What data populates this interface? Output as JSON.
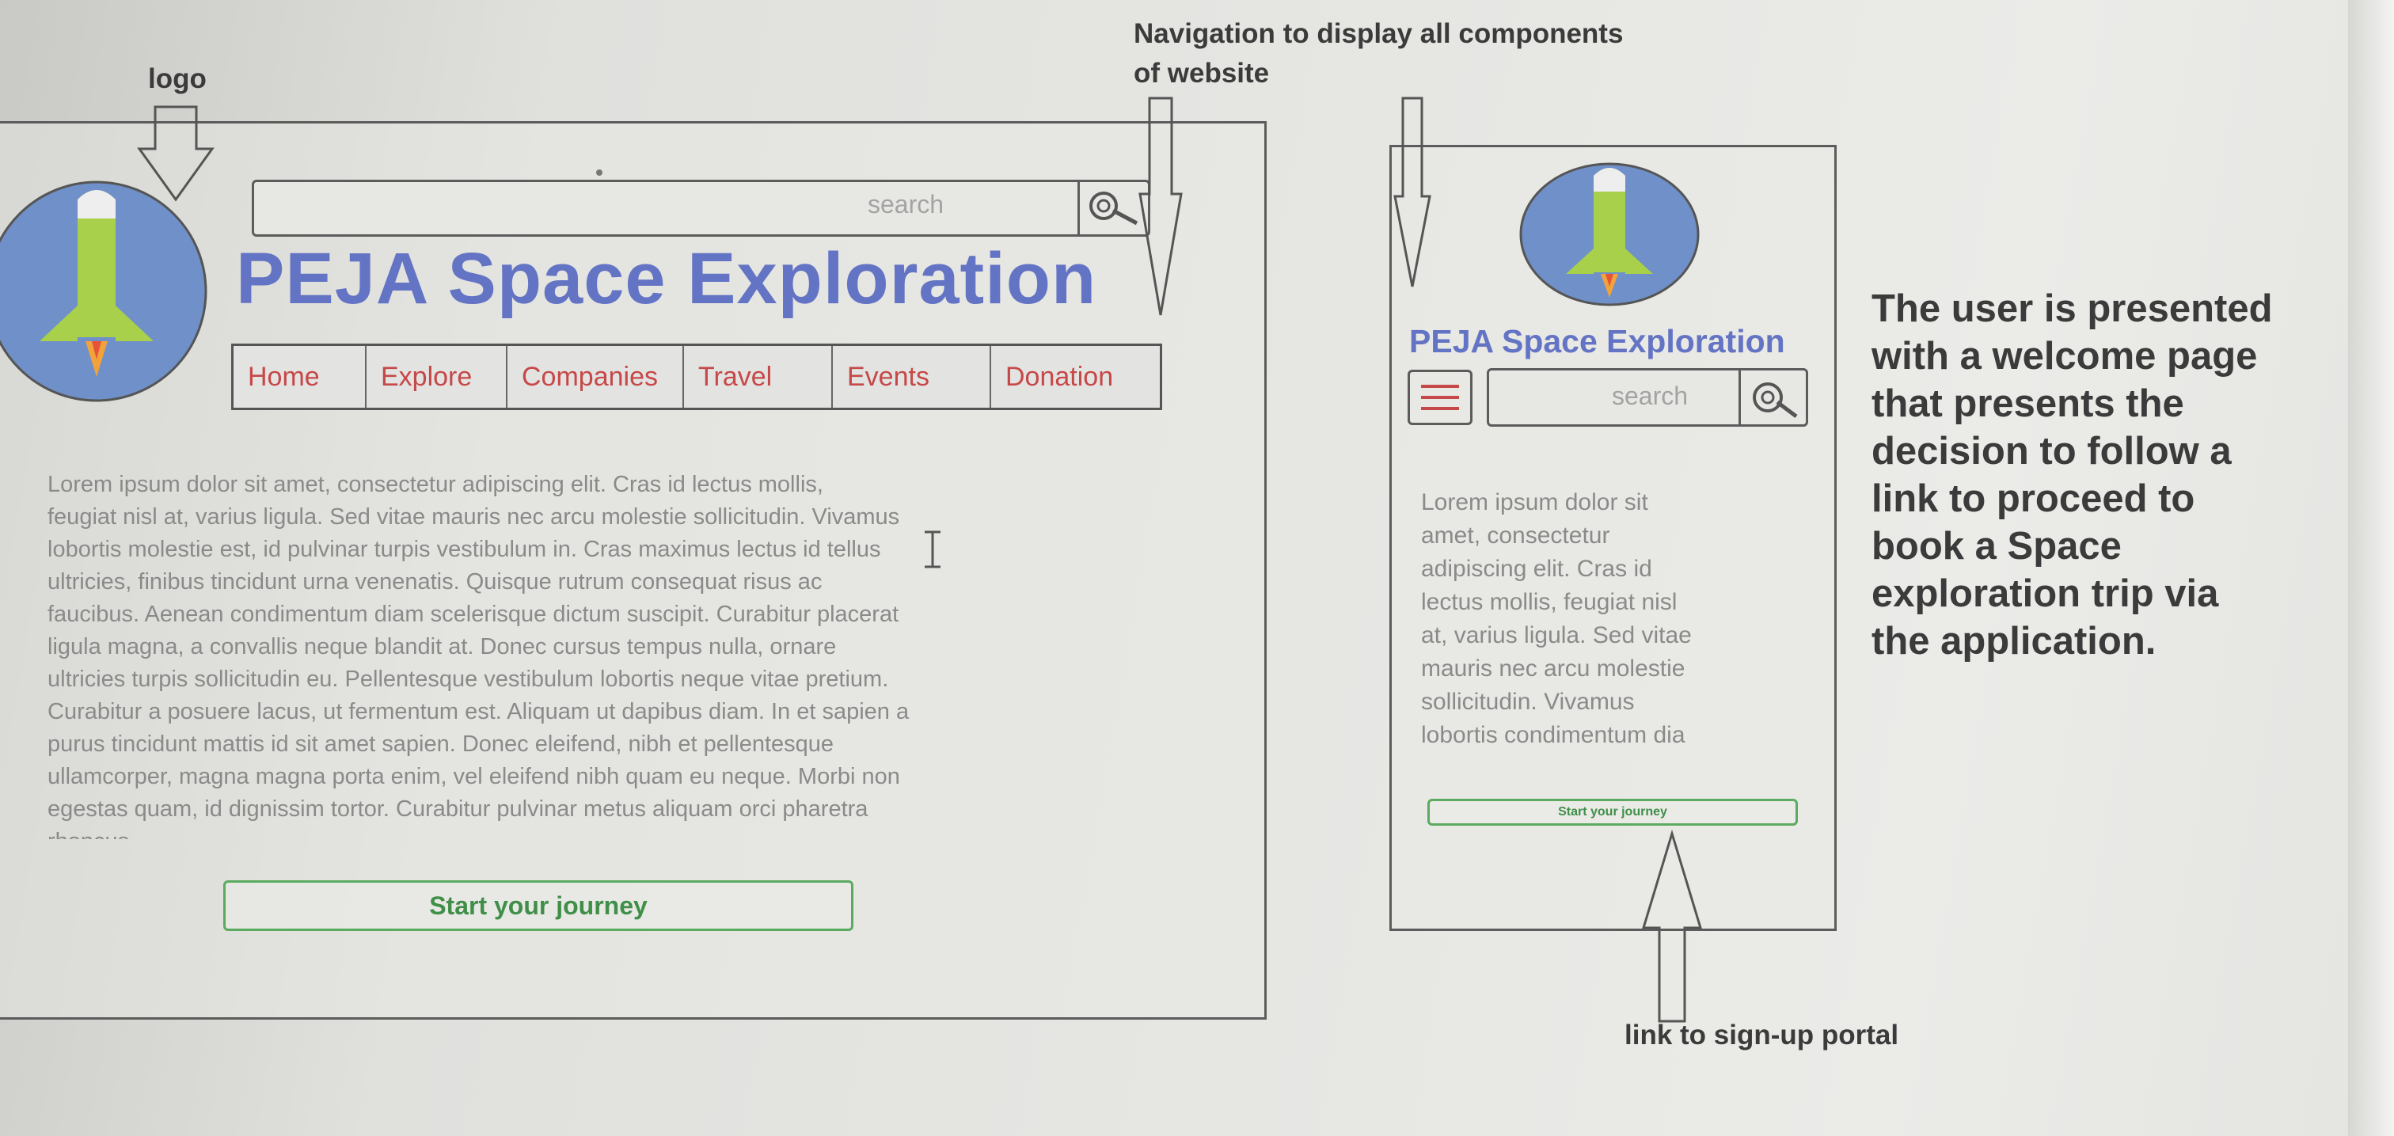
{
  "annotations": {
    "logo": "logo",
    "navigation_line1": "Navigation to display all components",
    "navigation_line2": "of website",
    "signup": "link to sign-up portal",
    "description_lines": [
      "The user is presented",
      "with a welcome page",
      "that presents the",
      "decision to follow a",
      "link to proceed to",
      "book a Space",
      "exploration trip via",
      "the application."
    ]
  },
  "desktop": {
    "search_placeholder": "search",
    "title": "PEJA Space Exploration",
    "nav": [
      "Home",
      "Explore",
      "Companies",
      "Travel",
      "Events",
      "Donation"
    ],
    "body_lines": [
      "Lorem ipsum dolor sit amet, consectetur adipiscing elit. Cras id lectus mollis,",
      "feugiat nisl at, varius ligula. Sed vitae mauris nec arcu molestie sollicitudin. Vivamus",
      "lobortis molestie est, id pulvinar turpis vestibulum in. Cras maximus lectus id tellus",
      "ultricies, finibus tincidunt urna venenatis. Quisque rutrum consequat risus ac",
      "faucibus. Aenean condimentum diam scelerisque dictum suscipit. Curabitur placerat",
      "ligula magna, a convallis neque blandit at. Donec cursus tempus nulla, ornare",
      "ultricies turpis sollicitudin eu. Pellentesque vestibulum lobortis neque vitae pretium.",
      "Curabitur a posuere lacus, ut fermentum est. Aliquam ut dapibus diam. In et sapien a",
      "purus tincidunt mattis id sit amet sapien. Donec eleifend, nibh et pellentesque",
      "ullamcorper, magna magna porta enim, vel eleifend nibh quam eu neque. Morbi non",
      "egestas quam, id dignissim tortor. Curabitur pulvinar metus aliquam orci pharetra",
      "rhoncus"
    ],
    "button_label": "Start your journey"
  },
  "mobile": {
    "title": "PEJA Space Exploration",
    "search_placeholder": "search",
    "body_lines": [
      "Lorem ipsum dolor sit",
      "amet, consectetur",
      "adipiscing elit. Cras id",
      "lectus mollis, feugiat nisl",
      "at, varius ligula. Sed vitae",
      "mauris nec arcu molestie",
      "sollicitudin. Vivamus",
      "lobortis condimentum dia"
    ],
    "button_label": "Start your journey"
  },
  "icons": {
    "logo": "rocket-logo-icon",
    "search": "magnifier-icon",
    "menu": "hamburger-menu-icon",
    "arrow": "hollow-arrow-icon"
  },
  "colors": {
    "title": "#6474c4",
    "nav_link": "#c64848",
    "button_border": "#5aaa60",
    "logo_circle": "#6f90c8",
    "rocket": "#a8d04a"
  }
}
